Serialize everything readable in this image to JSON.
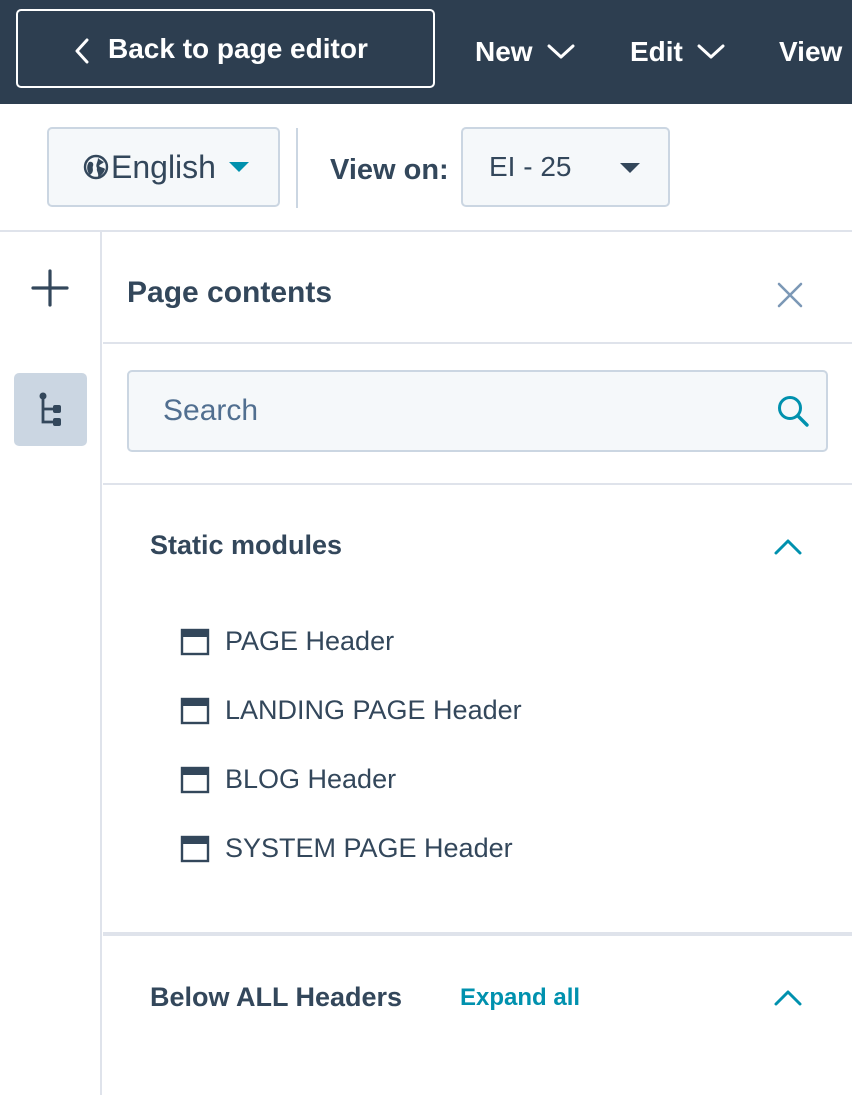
{
  "topbar": {
    "back_label": "Back to page editor",
    "menus": [
      {
        "label": "New"
      },
      {
        "label": "Edit"
      },
      {
        "label": "View"
      }
    ]
  },
  "toolbar": {
    "language": "English",
    "view_on_label": "View on:",
    "view_on_value": "EI - 25"
  },
  "panel": {
    "title": "Page contents",
    "search_placeholder": "Search",
    "sections": [
      {
        "title": "Static modules",
        "items": [
          "PAGE Header",
          "LANDING PAGE Header",
          "BLOG Header",
          "SYSTEM PAGE Header"
        ]
      },
      {
        "title": "Below ALL Headers",
        "action": "Expand all"
      }
    ]
  },
  "colors": {
    "topbar_bg": "#2d3e50",
    "accent": "#0091ae",
    "text": "#33475b",
    "border": "#cbd6e2"
  }
}
